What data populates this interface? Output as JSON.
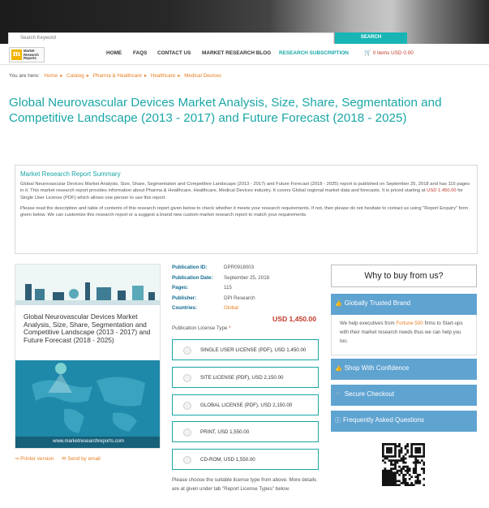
{
  "header": {
    "search_placeholder": "Search Keyword",
    "search_button": "SEARCH"
  },
  "logo": {
    "line1": "Market",
    "line2": "Research",
    "line3": "Reports"
  },
  "nav": {
    "items": [
      "HOME",
      "FAQS",
      "CONTACT US",
      "MARKET RESEARCH BLOG",
      "RESEARCH SUBSCRIPTION"
    ],
    "cart_text": "0 items USD 0.00"
  },
  "breadcrumb": {
    "prefix": "You are here:",
    "items": [
      "Home",
      "Catalog",
      "Pharma & Healthcare",
      "Healthcare",
      "Medical Devices"
    ]
  },
  "title": "Global Neurovascular Devices Market Analysis, Size, Share, Segmentation and Competitive Landscape (2013 - 2017) and Future Forecast (2018 - 2025)",
  "summary": {
    "heading": "Market Research Report Summary",
    "para1_a": "Global Neurovascular Devices Market Analysis, Size, Share, Segmentation and Competitive Landscape (2013 - 2017) and Future Forecast (2018 - 2025) report is published on September 25, 2018 and has 115 pages in it. This market research report provides information about Pharma & Healthcare, Healthcare, Medical Devices industry. It covers Global regional market data and forecasts. It is priced starting at",
    "para1_price": "USD 1,450.00",
    "para1_b": "for Single User License (PDF) which allows one person to use this report.",
    "para2": "Please read the description and table of contents of this research report given below to check whether it meets your research requirements. If not, then please do not hesitate to contact us using \"Report Enquiry\" form given below. We can customize this research report or a suggest a brand new custom market research report to match your requirements."
  },
  "product": {
    "caption": "Global Neurovascular Devices Market Analysis, Size, Share, Segmentation and Competitive Landscape (2013 - 2017) and Future Forecast (2018 - 2025)",
    "url": "www.marketresearchreports.com",
    "printer_link": "Printer version",
    "email_link": "Send by email"
  },
  "details": [
    {
      "label": "Publication ID:",
      "value": "DPR0918003"
    },
    {
      "label": "Publication Date:",
      "value": "September 25, 2018"
    },
    {
      "label": "Pages:",
      "value": "115"
    },
    {
      "label": "Publisher:",
      "value": "DPI Research"
    },
    {
      "label": "Countries:",
      "value": "Global"
    }
  ],
  "price": "USD 1,450.00",
  "license_type_label": "Publication License Type",
  "license_type_required": "*",
  "licenses": [
    "SINGLE USER LICENSE (PDF), USD 1,450.00",
    "SITE LICENSE (PDF), USD 2,150.00",
    "GLOBAL LICENSE (PDF), USD 2,150.00",
    "PRINT, USD 1,550.00",
    "CD-ROM, USD 1,550.00"
  ],
  "license_note": "Please choose the suitable license type from above. More details are at given under tab \"Report License Types\" below.",
  "sidebar": {
    "why_buy": "Why to buy from us?",
    "trusted_title": "Globally Trusted Brand",
    "trusted_a": "We help executives from",
    "trusted_hl": "Fortune 500",
    "trusted_b": "firms to Start-ups with their market research needs thus we can help you too.",
    "shop": "Shop With Confidence",
    "checkout": "Secure Checkout",
    "faq": "Frequently Asked Questions"
  },
  "colors": {
    "accent": "#1aa6a6",
    "link": "#e67e22",
    "price": "#c0392b",
    "sidebar": "#5fa3d1"
  }
}
